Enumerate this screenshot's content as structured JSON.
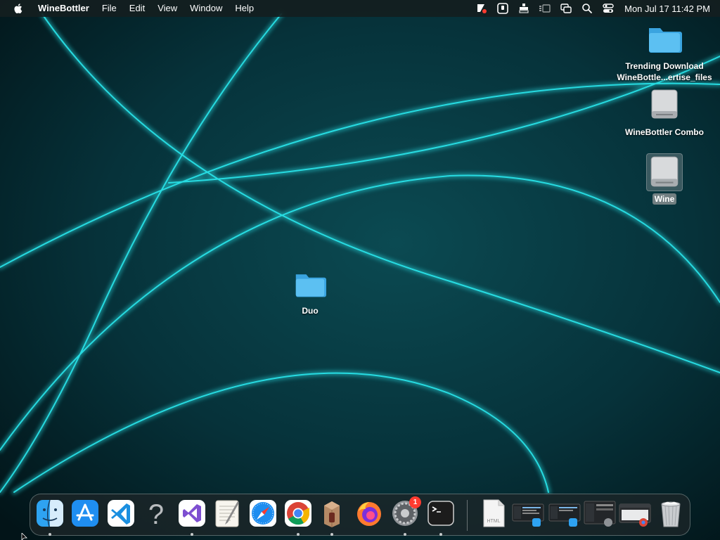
{
  "menubar": {
    "app_name": "WineBottler",
    "menus": [
      "File",
      "Edit",
      "View",
      "Window",
      "Help"
    ],
    "status_icons": [
      "wine-status-icon",
      "screen-record-icon",
      "display-icon",
      "stage-manager-icon",
      "window-switch-icon",
      "spotlight-search-icon",
      "control-center-icon"
    ],
    "clock": "Mon Jul 17  11:42 PM"
  },
  "desktop": {
    "icons": [
      {
        "name": "trending-download-folder",
        "line1": "Trending Download",
        "line2": "WineBottle...ertise_files",
        "type": "folder"
      },
      {
        "name": "winebottler-combo-drive",
        "label": "WineBottler Combo",
        "type": "drive"
      },
      {
        "name": "wine-drive",
        "label": "Wine",
        "type": "drive",
        "selected": true
      },
      {
        "name": "duo-folder",
        "label": "Duo",
        "type": "folder"
      }
    ]
  },
  "dock": {
    "items": [
      {
        "name": "finder",
        "running": true
      },
      {
        "name": "app-store",
        "running": false
      },
      {
        "name": "visual-studio-code",
        "running": false
      },
      {
        "name": "unknown-app",
        "running": false
      },
      {
        "name": "visual-studio",
        "running": true
      },
      {
        "name": "textedit",
        "running": false
      },
      {
        "name": "safari",
        "running": false
      },
      {
        "name": "chrome",
        "running": true
      },
      {
        "name": "winebottler",
        "running": true
      },
      {
        "name": "firefox",
        "running": false
      },
      {
        "name": "system-settings",
        "running": true,
        "badge": "1"
      },
      {
        "name": "terminal",
        "running": true
      }
    ],
    "minimized": [
      "html-file",
      "finder-window-1",
      "finder-window-2",
      "system-settings-window",
      "chrome-window"
    ],
    "trash": "trash",
    "question_mark": "?",
    "html_doc_label": "HTML"
  },
  "colors": {
    "accent": "#27e4ea",
    "folder_blue": "#4fb3ec",
    "menubar_bg": "#141e20"
  }
}
